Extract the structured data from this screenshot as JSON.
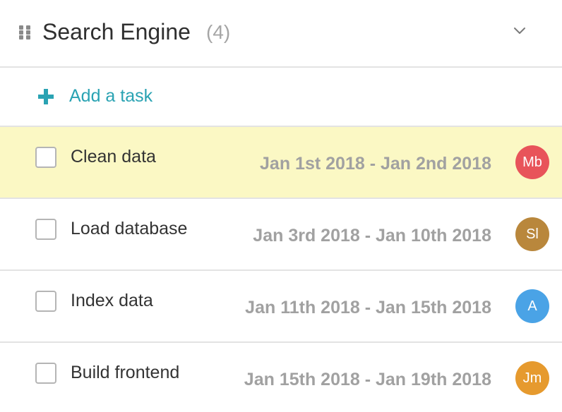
{
  "list": {
    "title": "Search Engine",
    "count": "(4)",
    "add_task_label": "Add a task"
  },
  "colors": {
    "accent": "#2aa3b3",
    "highlight": "#fbf8c4"
  },
  "tasks": [
    {
      "name": "Clean data",
      "dates": "Jan 1st 2018 - Jan 2nd 2018",
      "assignee": "Mb",
      "avatar_color": "#e8545a",
      "highlighted": true
    },
    {
      "name": "Load database",
      "dates": "Jan 3rd 2018 - Jan 10th 2018",
      "assignee": "Sl",
      "avatar_color": "#b9873c",
      "highlighted": false
    },
    {
      "name": "Index data",
      "dates": "Jan 11th 2018 - Jan 15th 2018",
      "assignee": "A",
      "avatar_color": "#4aa3e6",
      "highlighted": false
    },
    {
      "name": "Build frontend",
      "dates": "Jan 15th 2018 - Jan 19th 2018",
      "assignee": "Jm",
      "avatar_color": "#e69a2e",
      "highlighted": false
    }
  ]
}
